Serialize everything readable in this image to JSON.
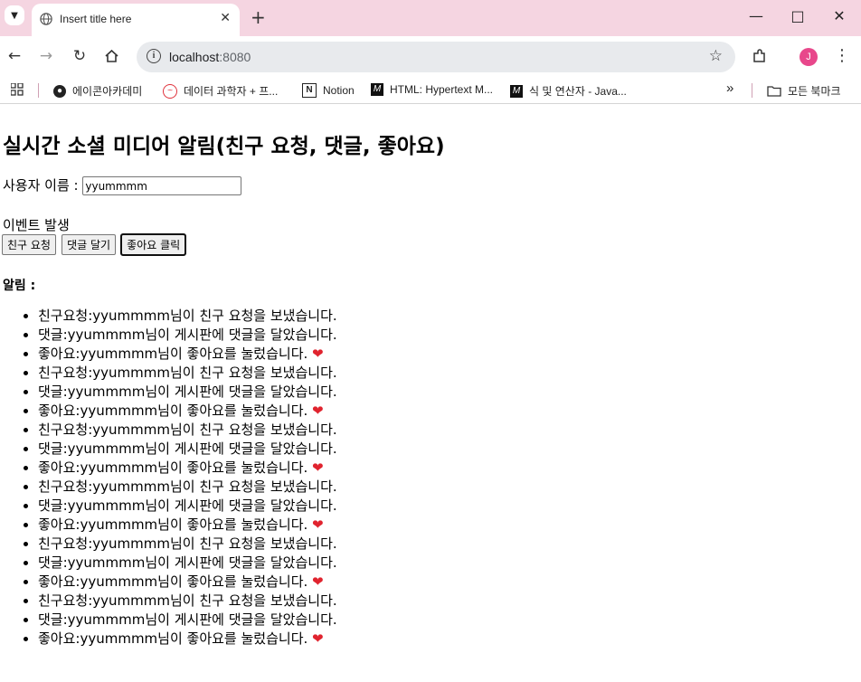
{
  "browser": {
    "tab_title": "Insert title here",
    "url_host": "localhost",
    "url_port": ":8080",
    "avatar_initial": "J",
    "bookmarks": [
      {
        "label": "에이콘아카데미"
      },
      {
        "label": "데이터 과학자 + 프..."
      },
      {
        "label": "Notion"
      },
      {
        "label": "HTML: Hypertext M..."
      },
      {
        "label": "식 및 연산자 - Java..."
      }
    ],
    "overflow_label": "»",
    "all_bookmarks_label": "모든 북마크"
  },
  "page": {
    "heading": "실시간 소셜 미디어 알림(친구 요청, 댓글, 좋아요)",
    "username_label": "사용자 이름 : ",
    "username_value": "yyummmm",
    "event_label": "이벤트 발생",
    "buttons": {
      "friend_request": "친구 요청",
      "comment": "댓글 달기",
      "like": "좋아요 클릭"
    },
    "alerts_label": "알림 :",
    "notifications": [
      {
        "text": "친구요청:yyummmm님이 친구 요청을 보냈습니다.",
        "heart": ""
      },
      {
        "text": "댓글:yyummmm님이 게시판에 댓글을 달았습니다.",
        "heart": ""
      },
      {
        "text": "좋아요:yyummmm님이 좋아요를 눌렀습니다. ",
        "heart": "❤"
      },
      {
        "text": "친구요청:yyummmm님이 친구 요청을 보냈습니다.",
        "heart": ""
      },
      {
        "text": "댓글:yyummmm님이 게시판에 댓글을 달았습니다.",
        "heart": ""
      },
      {
        "text": "좋아요:yyummmm님이 좋아요를 눌렀습니다. ",
        "heart": "❤"
      },
      {
        "text": "친구요청:yyummmm님이 친구 요청을 보냈습니다.",
        "heart": ""
      },
      {
        "text": "댓글:yyummmm님이 게시판에 댓글을 달았습니다.",
        "heart": ""
      },
      {
        "text": "좋아요:yyummmm님이 좋아요를 눌렀습니다. ",
        "heart": "❤"
      },
      {
        "text": "친구요청:yyummmm님이 친구 요청을 보냈습니다.",
        "heart": ""
      },
      {
        "text": "댓글:yyummmm님이 게시판에 댓글을 달았습니다.",
        "heart": ""
      },
      {
        "text": "좋아요:yyummmm님이 좋아요를 눌렀습니다. ",
        "heart": "❤"
      },
      {
        "text": "친구요청:yyummmm님이 친구 요청을 보냈습니다.",
        "heart": ""
      },
      {
        "text": "댓글:yyummmm님이 게시판에 댓글을 달았습니다.",
        "heart": ""
      },
      {
        "text": "좋아요:yyummmm님이 좋아요를 눌렀습니다. ",
        "heart": "❤"
      },
      {
        "text": "친구요청:yyummmm님이 친구 요청을 보냈습니다.",
        "heart": ""
      },
      {
        "text": "댓글:yyummmm님이 게시판에 댓글을 달았습니다.",
        "heart": ""
      },
      {
        "text": "좋아요:yyummmm님이 좋아요를 눌렀습니다. ",
        "heart": "❤"
      }
    ]
  },
  "colors": {
    "tabbar_bg": "#f5d5e1",
    "avatar_bg": "#e8478b",
    "heart": "#e0232e"
  }
}
